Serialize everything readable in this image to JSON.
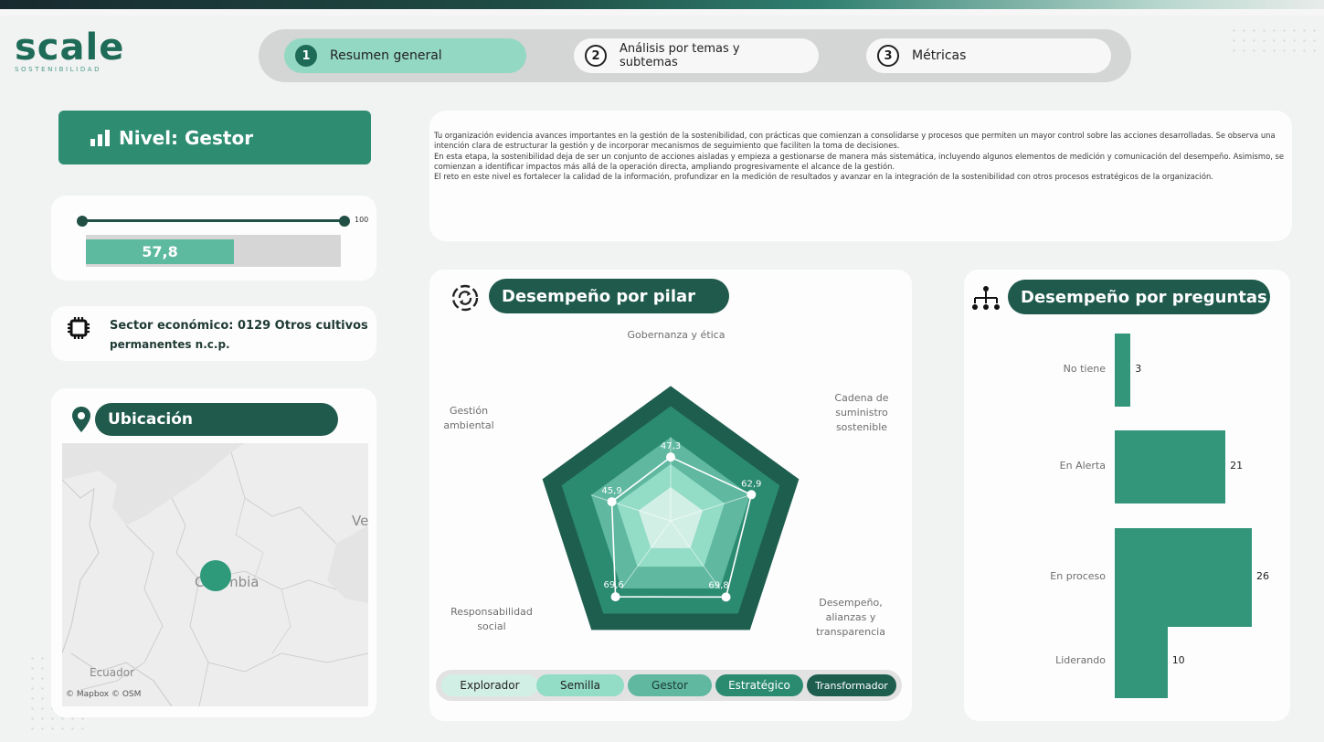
{
  "brand": {
    "name": "scale",
    "tagline": "SOSTENIBILIDAD",
    "color": "#1e6b57"
  },
  "steps": [
    {
      "num": "1",
      "label": "Resumen general",
      "active": true
    },
    {
      "num": "2",
      "label": "Análisis por temas y subtemas",
      "active": false
    },
    {
      "num": "3",
      "label": "Métricas",
      "active": false
    }
  ],
  "level": {
    "label": "Nivel: Gestor",
    "score_text": "57,8",
    "score": 57.8,
    "max": "100"
  },
  "sector": {
    "line1": "Sector económico: 0129 Otros cultivos",
    "line2": "permanentes n.c.p."
  },
  "location": {
    "title": "Ubicación",
    "map_labels": {
      "country": "Colombia",
      "neighbor_east": "Ve",
      "neighbor_south": "Ecuador"
    },
    "attribution": "© Mapbox  © OSM"
  },
  "description": [
    "Tu organización evidencia avances importantes en la gestión de la sostenibilidad, con prácticas que comienzan a consolidarse y procesos que permiten un mayor control sobre las acciones desarrolladas. Se observa una intención clara de estructurar la gestión y de incorporar mecanismos de seguimiento que faciliten la toma de decisiones.",
    "En esta etapa, la sostenibilidad deja de ser un conjunto de acciones aisladas y empieza a gestionarse de manera más sistemática, incluyendo algunos elementos de medición y comunicación del desempeño. Asimismo, se comienzan a identificar impactos más allá de la operación directa, ampliando progresivamente el alcance de la gestión.",
    "El reto en este nivel es fortalecer la calidad de la información, profundizar en la medición de resultados y avanzar en la integración de la sostenibilidad con otros procesos estratégicos de la organización."
  ],
  "pillar_panel": {
    "title": "Desempeño por pilar",
    "axes": [
      {
        "label": "Gobernanza y ética",
        "value": 47.3,
        "value_text": "47,3"
      },
      {
        "label": "Cadena de suministro sostenible",
        "value": 62.9,
        "value_text": "62,9"
      },
      {
        "label": "Desempeño, alianzas y transparencia",
        "value": 69.8,
        "value_text": "69,8"
      },
      {
        "label": "Responsabilidad social",
        "value": 69.6,
        "value_text": "69,6"
      },
      {
        "label": "Gestión ambiental",
        "value": 45.9,
        "value_text": "45,9"
      }
    ],
    "levels": [
      {
        "label": "Explorador",
        "color": "#d2efe6"
      },
      {
        "label": "Semilla",
        "color": "#93dcc6"
      },
      {
        "label": "Gestor",
        "color": "#5fb89f"
      },
      {
        "label": "Estratégico",
        "color": "#2b8b70"
      },
      {
        "label": "Transformador",
        "color": "#1e5e4f"
      }
    ]
  },
  "questions_panel": {
    "title": "Desempeño por  preguntas",
    "bar_color": "#33957a"
  },
  "chart_data": {
    "type": "bar",
    "orientation": "horizontal",
    "categories": [
      "No tiene",
      "En Alerta",
      "En proceso",
      "Liderando"
    ],
    "values": [
      3,
      21,
      26,
      10
    ]
  }
}
